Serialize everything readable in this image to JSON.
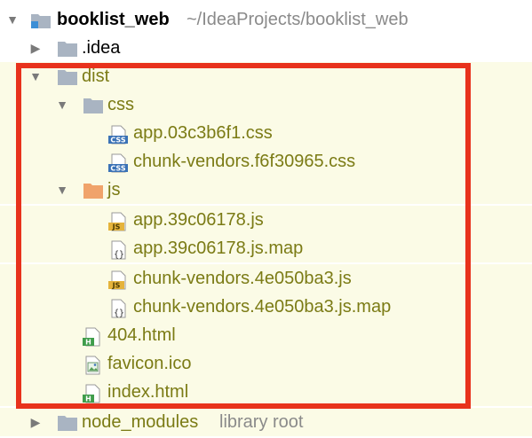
{
  "project": {
    "name": "booklist_web",
    "path": "~/IdeaProjects/booklist_web"
  },
  "tree": [
    {
      "label": ".idea"
    },
    {
      "label": "dist"
    },
    {
      "label": "css"
    },
    {
      "label": "app.03c3b6f1.css",
      "badge": "CSS"
    },
    {
      "label": "chunk-vendors.f6f30965.css",
      "badge": "CSS"
    },
    {
      "label": "js"
    },
    {
      "label": "app.39c06178.js",
      "badge": "JS"
    },
    {
      "label": "app.39c06178.js.map",
      "badge": "{}"
    },
    {
      "label": "chunk-vendors.4e050ba3.js",
      "badge": "JS"
    },
    {
      "label": "chunk-vendors.4e050ba3.js.map",
      "badge": "{}"
    },
    {
      "label": "404.html",
      "badge": "H"
    },
    {
      "label": "favicon.ico"
    },
    {
      "label": "index.html",
      "badge": "H"
    },
    {
      "label": "node_modules",
      "suffix": "library root"
    }
  ],
  "colors": {
    "highlight": "#e8321c",
    "excluded_text": "#7b7b15",
    "excluded_bg": "#fbfbe6",
    "folder": "#a9b4c2",
    "js_folder": "#f0a36b"
  }
}
